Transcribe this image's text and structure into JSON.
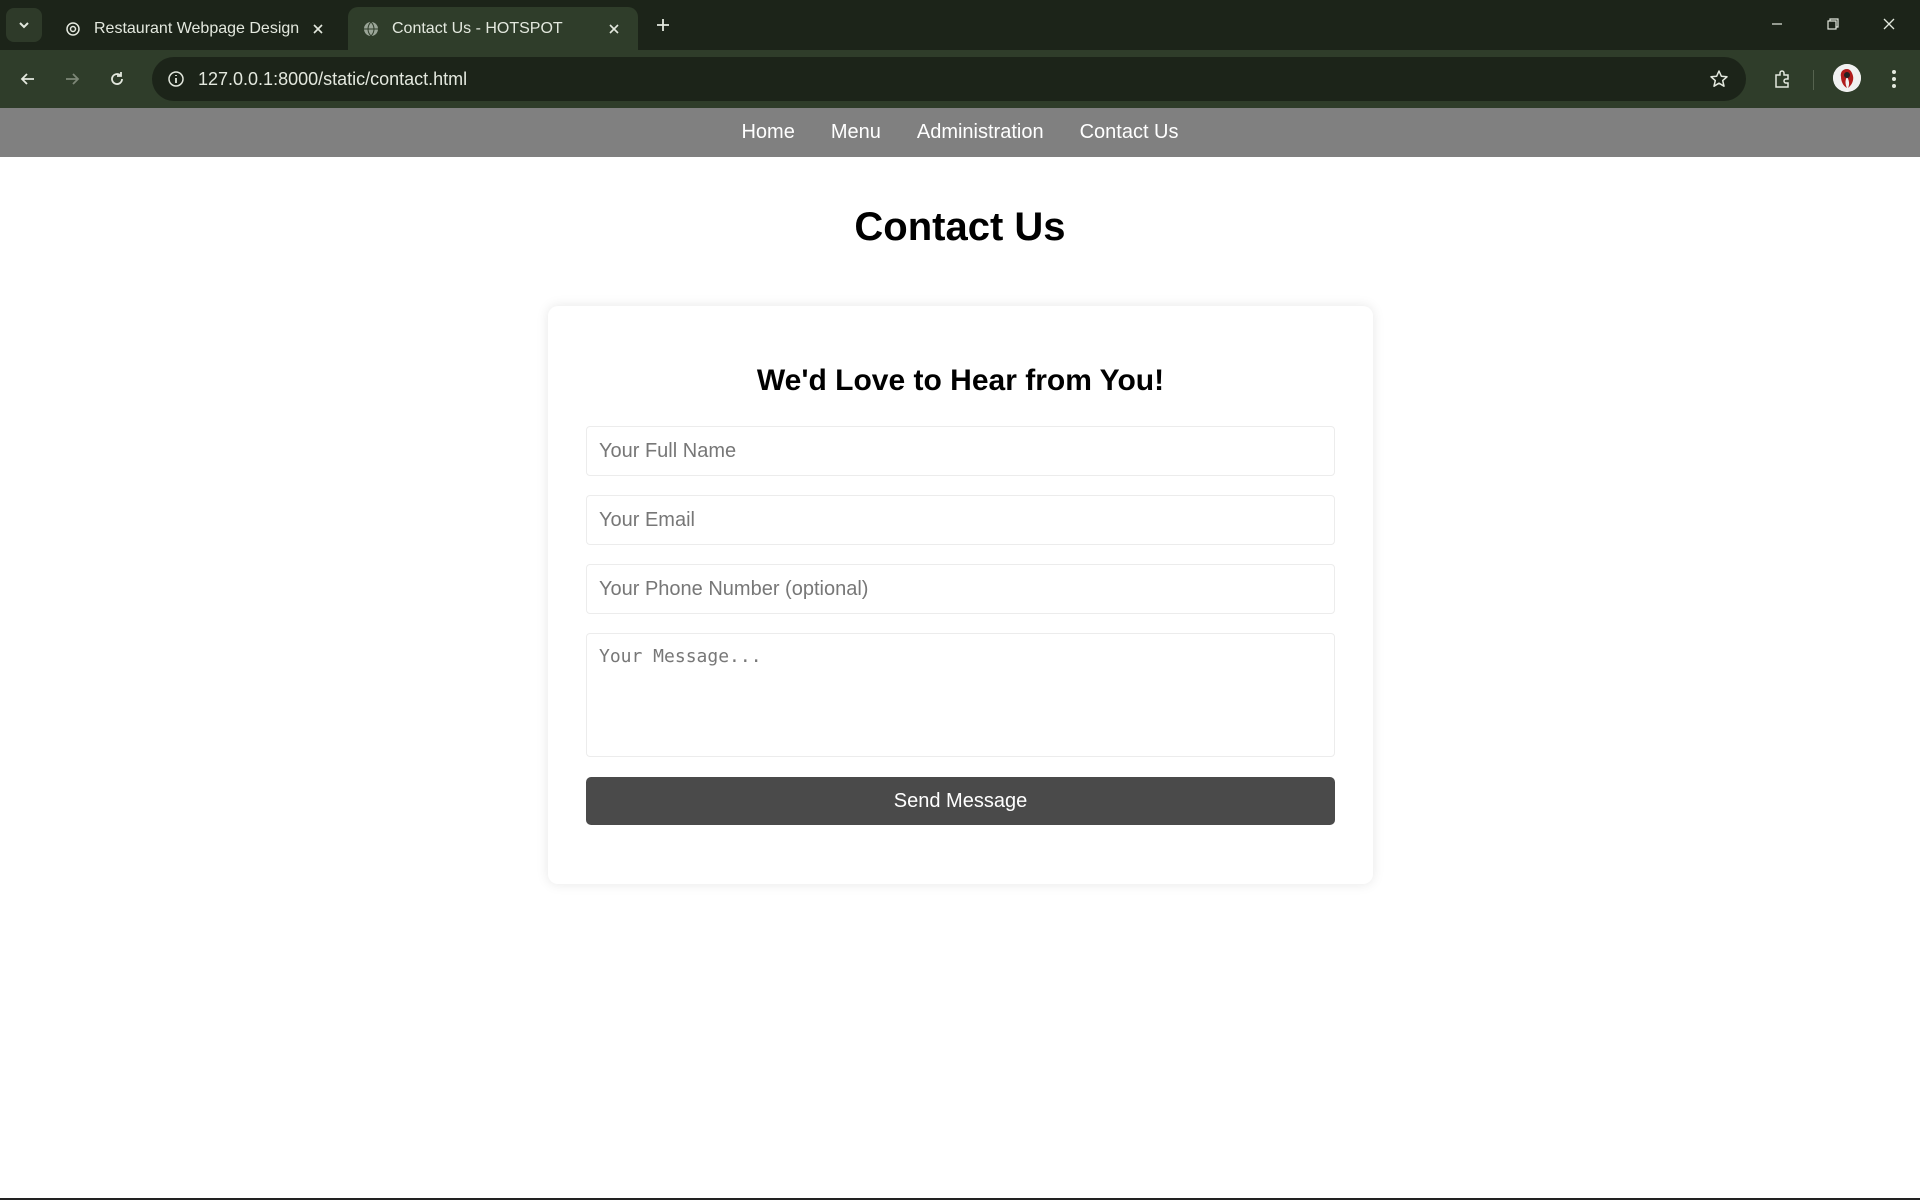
{
  "browser": {
    "tabs": [
      {
        "title": "Restaurant Webpage Design",
        "icon": "openai-icon",
        "active": false
      },
      {
        "title": "Contact Us - HOTSPOT",
        "icon": "globe-icon",
        "active": true
      }
    ],
    "url": "127.0.0.1:8000/static/contact.html",
    "colors": {
      "frame": "#1c2419",
      "toolbar": "#2f3d2a",
      "text": "#e3e8de"
    }
  },
  "site_nav": {
    "items": [
      "Home",
      "Menu",
      "Administration",
      "Contact Us"
    ],
    "background": "#808080"
  },
  "page": {
    "title": "Contact Us"
  },
  "form": {
    "heading": "We'd Love to Hear from You!",
    "name_placeholder": "Your Full Name",
    "email_placeholder": "Your Email",
    "phone_placeholder": "Your Phone Number (optional)",
    "message_placeholder": "Your Message...",
    "submit_label": "Send Message",
    "button_color": "#4a4a4a"
  }
}
